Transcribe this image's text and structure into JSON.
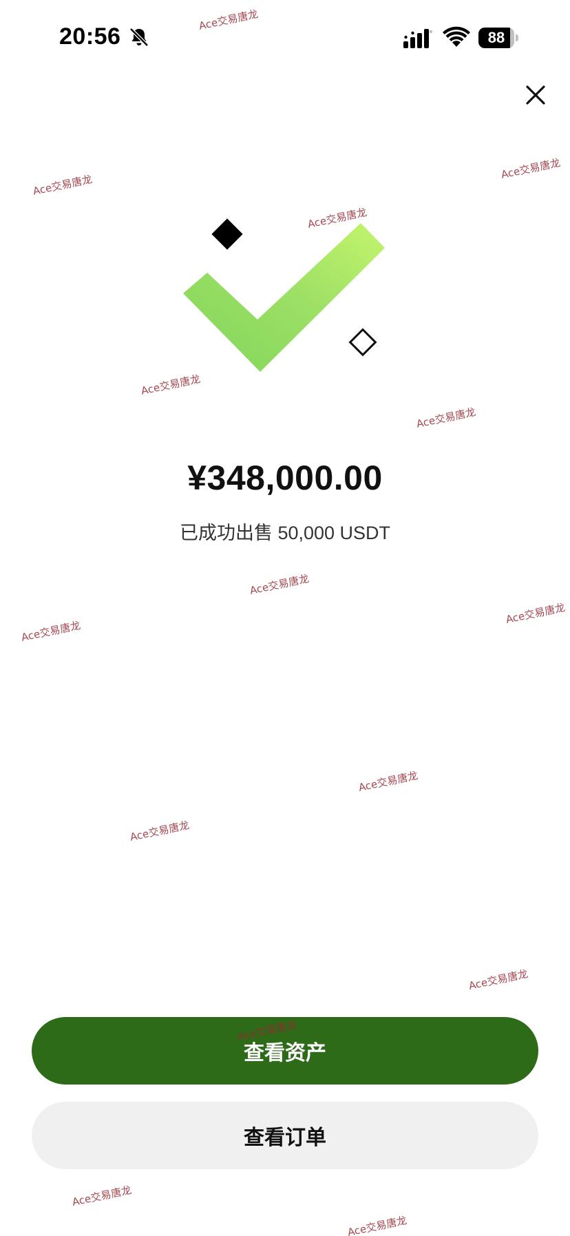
{
  "status_bar": {
    "time": "20:56",
    "battery_level": "88",
    "battery_fraction": 0.88
  },
  "icons": {
    "mute": "bell-slash-icon",
    "signal": "cellular-signal-icon",
    "wifi": "wifi-icon",
    "close": "close-icon",
    "success": "checkmark-icon"
  },
  "colors": {
    "primary_button": "#2d6b18",
    "secondary_button": "#f0f0f0",
    "check_light": "#c4f56c",
    "check_dark": "#7fd65a",
    "watermark": "#962832"
  },
  "result": {
    "amount": "¥348,000.00",
    "description": "已成功出售 50,000 USDT"
  },
  "actions": {
    "view_assets": "查看资产",
    "view_orders": "查看订单"
  },
  "watermark": {
    "text": "Ace交易唐龙"
  }
}
